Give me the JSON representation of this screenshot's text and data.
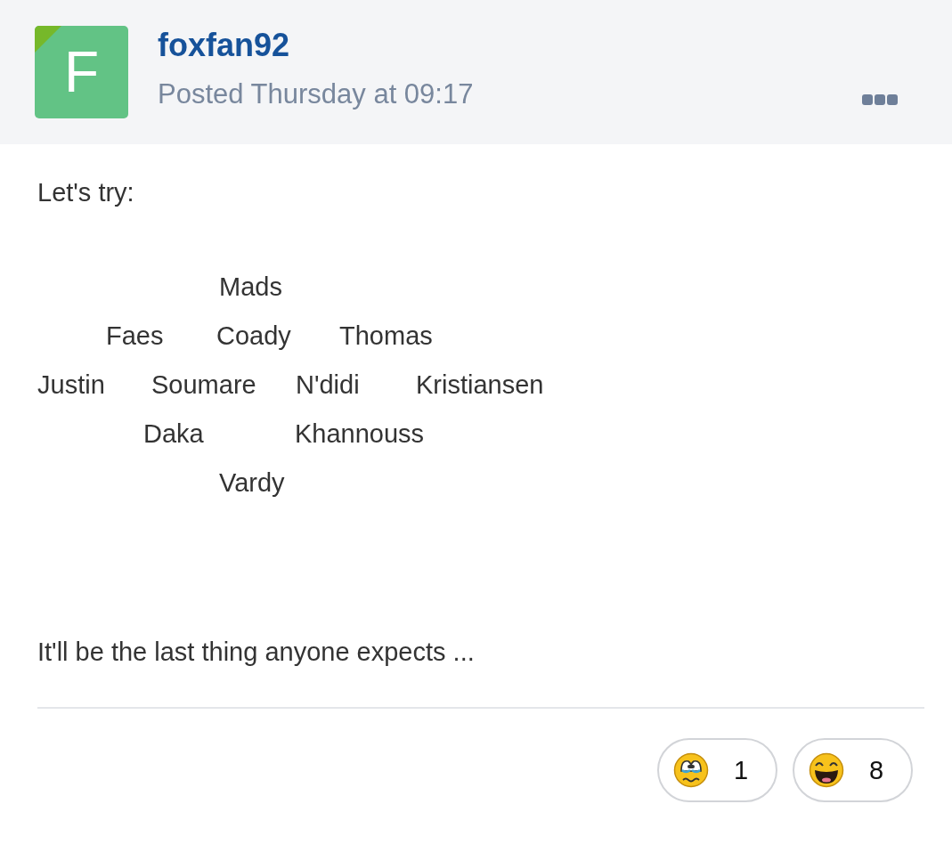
{
  "post": {
    "author": "foxfan92",
    "avatar_letter": "F",
    "posted": "Posted Thursday at 09:17",
    "intro": "Let's try:",
    "formation": [
      [
        "Mads"
      ],
      [
        "Faes",
        "Coady",
        "Thomas"
      ],
      [
        "Justin",
        "Soumare",
        "N'didi",
        "Kristiansen"
      ],
      [
        "Daka",
        "Khannouss"
      ],
      [
        "Vardy"
      ]
    ],
    "closing": "It'll be the last thing anyone expects ...",
    "reactions": [
      {
        "kind": "sad",
        "count": "1"
      },
      {
        "kind": "laugh",
        "count": "8"
      }
    ]
  }
}
